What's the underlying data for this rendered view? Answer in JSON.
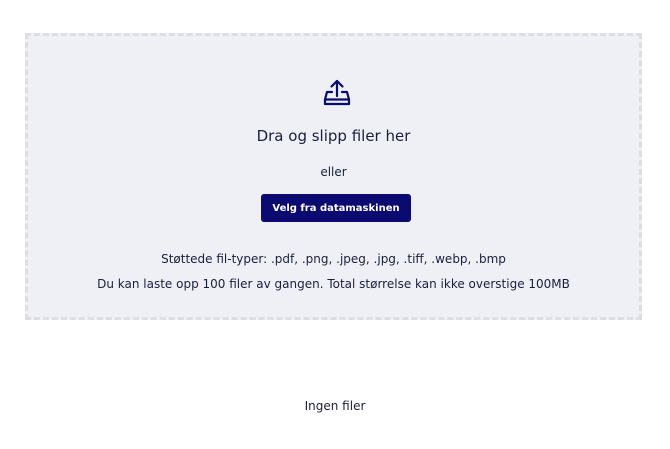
{
  "dropzone": {
    "icon": "upload-icon",
    "title": "Dra og slipp filer her",
    "or_text": "eller",
    "choose_button_label": "Velg fra datamaskinen",
    "supported_types": "Støttede fil-typer: .pdf, .png, .jpeg, .jpg, .tiff, .webp, .bmp",
    "limit_text": "Du kan laste opp 100 filer av gangen. Total størrelse kan ikke overstige 100MB"
  },
  "file_list": {
    "empty_text": "Ingen filer"
  },
  "colors": {
    "accent": "#0b0a70",
    "dropzone_background": "#eef0f6",
    "dropzone_border": "#dcdee3",
    "text": "#1b1f3b"
  }
}
